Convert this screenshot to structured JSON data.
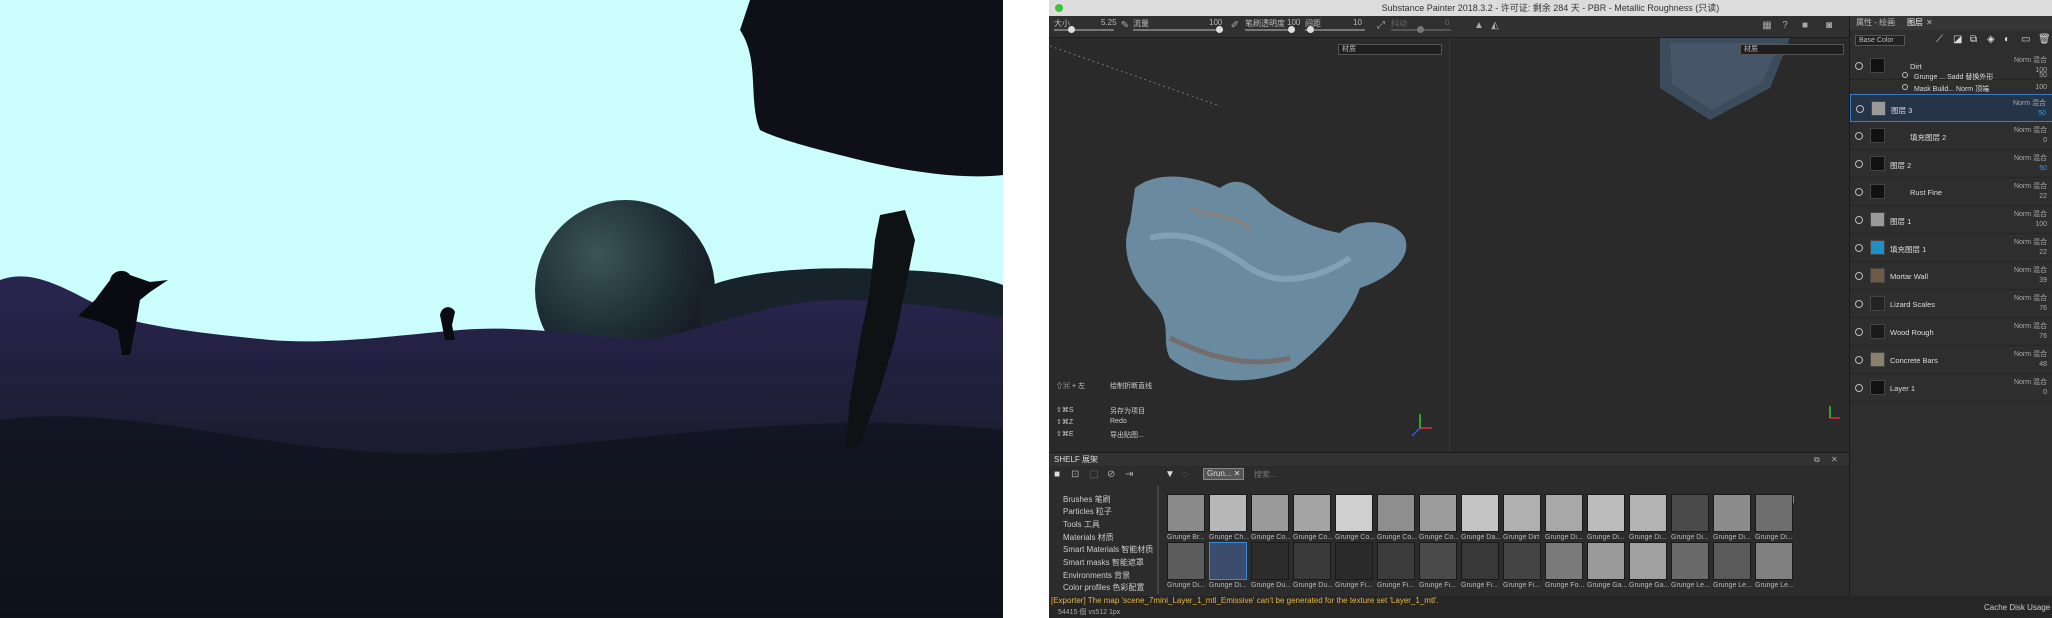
{
  "app": {
    "title": "Substance Painter 2018.3.2 - 许可证: 剩余 284 天 - PBR - Metallic Roughness (只读)"
  },
  "toolbar": {
    "params": [
      {
        "label": "大小",
        "value": "5.25"
      },
      {
        "label": "流量",
        "value": "100"
      },
      {
        "label": "笔刷透明度",
        "value": "100"
      },
      {
        "label": "间距",
        "value": "10"
      },
      {
        "label": "抖动",
        "value": "0"
      }
    ],
    "icons": [
      "pen-icon",
      "brush-icon",
      "stabilize-icon",
      "triangle-icon",
      "symmetry-icon",
      "help-icon",
      "camera-icon",
      "video-icon",
      "screenshot-icon"
    ]
  },
  "viewport": {
    "left_dropdown": "材质",
    "right_dropdown": "材质",
    "shortcuts": [
      {
        "key": "⇧⌘ + 左",
        "label": "绘制折断直线"
      },
      {
        "key": "⇧⌘S",
        "label": "另存为项目"
      },
      {
        "key": "⇧⌘Z",
        "label": "Redo"
      },
      {
        "key": "⇧⌘E",
        "label": "导出贴图..."
      }
    ]
  },
  "shelf": {
    "title": "SHELF 展架",
    "search_tag": "Grun...",
    "search_placeholder": "搜索...",
    "categories": [
      "Brushes 笔刷",
      "Particles 粒子",
      "Tools 工具",
      "Materials 材质",
      "Smart Materials 智能材质",
      "Smart masks 智能遮罩",
      "Environments 背景",
      "Color profiles 色彩配置"
    ],
    "row1": [
      "Grunge Br...",
      "Grunge Ch...",
      "Grunge Co...",
      "Grunge Co...",
      "Grunge Co...",
      "Grunge Co...",
      "Grunge Co...",
      "Grunge Da...",
      "Grunge Dirt",
      "Grunge Di...",
      "Grunge Di...",
      "Grunge Di...",
      "Grunge Di...",
      "Grunge Di...",
      "Grunge Di..."
    ],
    "row2": [
      "Grunge Di...",
      "Grunge Di...",
      "Grunge Du...",
      "Grunge Du...",
      "Grunge Fi...",
      "Grunge Fi...",
      "Grunge Fi...",
      "Grunge Fi...",
      "Grunge Fi...",
      "Grunge Fo...",
      "Grunge Ga...",
      "Grunge Ga...",
      "Grunge Le...",
      "Grunge Le...",
      "Grunge Le..."
    ],
    "thumb_colors": [
      "#8a8a8a",
      "#b8b8b8",
      "#9a9a9a",
      "#a4a4a4",
      "#cfcfcf",
      "#8e8e8e",
      "#9c9c9c",
      "#c4c4c4",
      "#b0b0b0",
      "#a8a8a8",
      "#bcbcbc",
      "#b4b4b4",
      "#4a4a4a",
      "#8c8c8c",
      "#6e6e6e",
      "#5c5c5c",
      "#3c4c6c",
      "#2c2c2c",
      "#3a3a3a",
      "#2a2a2a",
      "#3c3c3c",
      "#4a4a4a",
      "#383838",
      "#444444",
      "#7a7a7a",
      "#9a9a9a",
      "#a0a0a0",
      "#6a6a6a",
      "#5a5a5a",
      "#808080"
    ]
  },
  "status": {
    "warning": "[Exporter] The map 'scene_7mini_Layer_1_mtl_Emissive' can't be generated for the texture set 'Layer_1_mtl'.",
    "info": "54415 個 vs512 1px",
    "cache": "Cache Disk Usage"
  },
  "right_panel": {
    "tabs": [
      "属性 - 绘画",
      "图层"
    ],
    "channel": "Base Color",
    "layers": [
      {
        "name": "Dirt",
        "blend": "Norm 混合",
        "opacity": "100",
        "color": "#111111"
      },
      {
        "name": "Grunge ... Sadd 替换外形",
        "blend": "",
        "opacity": "50",
        "color": "#333333"
      },
      {
        "name": "Mask Build... Norm 顶端",
        "blend": "",
        "opacity": "100",
        "color": "#333333"
      },
      {
        "name": "图层 3",
        "blend": "Norm 混合",
        "opacity": "50",
        "color": "#9a9a9a"
      },
      {
        "name": "填充图层 2",
        "blend": "Norm 混合",
        "opacity": "0",
        "color": "#111111"
      },
      {
        "name": "图层 2",
        "blend": "Norm 混合",
        "opacity": "50",
        "color": "#111111"
      },
      {
        "name": "Rust Fine",
        "blend": "Norm 混合",
        "opacity": "22",
        "color": "#111111"
      },
      {
        "name": "图层 1",
        "blend": "Norm 混合",
        "opacity": "100",
        "color": "#9a9a9a"
      },
      {
        "name": "填充图层 1",
        "blend": "Norm 混合",
        "opacity": "22",
        "color": "#1e8fc8"
      },
      {
        "name": "Mortar Wall",
        "blend": "Norm 混合",
        "opacity": "39",
        "color": "#6e5a48"
      },
      {
        "name": "Lizard Scales",
        "blend": "Norm 混合",
        "opacity": "76",
        "color": "#222222"
      },
      {
        "name": "Wood Rough",
        "blend": "Norm 混合",
        "opacity": "76",
        "color": "#1a1a1a"
      },
      {
        "name": "Concrete Bars",
        "blend": "Norm 混合",
        "opacity": "48",
        "color": "#8a8070"
      },
      {
        "name": "Layer 1",
        "blend": "Norm 混合",
        "opacity": "0",
        "color": "#111111"
      }
    ]
  }
}
